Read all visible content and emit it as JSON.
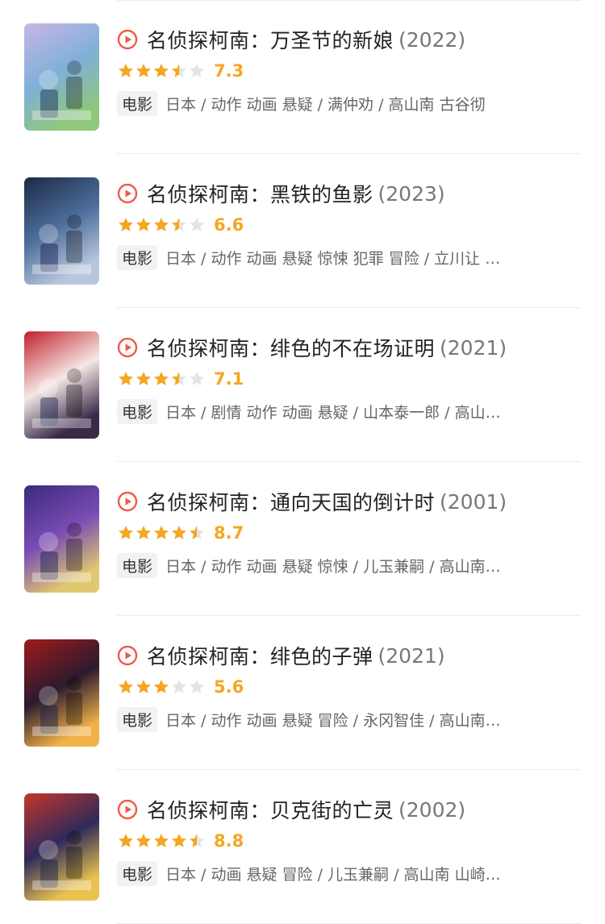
{
  "accent_color": "#f5a623",
  "play_icon_color": "#f15a4a",
  "items": [
    {
      "title": "名侦探柯南：万圣节的新娘",
      "year": "(2022)",
      "score": "7.3",
      "stars": 3.5,
      "type": "电影",
      "meta": "日本 / 动作 动画 悬疑 / 满仲劝 / 高山南 古谷彻",
      "poster_colors": [
        "#c7b6e6",
        "#7fb0d8",
        "#8fc77d"
      ]
    },
    {
      "title": "名侦探柯南：黑铁的鱼影",
      "year": "(2023)",
      "score": "6.6",
      "stars": 3.5,
      "type": "电影",
      "meta": "日本 / 动作 动画 悬疑 惊悚 犯罪 冒险 / 立川让 / 高山南 山崎和佳奈",
      "poster_colors": [
        "#1c2a44",
        "#4d6e9c",
        "#b7c6dc"
      ]
    },
    {
      "title": "名侦探柯南：绯色的不在场证明",
      "year": "(2021)",
      "score": "7.1",
      "stars": 3.5,
      "type": "电影",
      "meta": "日本 / 剧情 动作 动画 悬疑 / 山本泰一郎 / 高山南 山崎和佳奈",
      "poster_colors": [
        "#c21f2a",
        "#f4e8e4",
        "#3a2a4a"
      ]
    },
    {
      "title": "名侦探柯南：通向天国的倒计时",
      "year": "(2001)",
      "score": "8.7",
      "stars": 4.5,
      "type": "电影",
      "meta": "日本 / 动作 动画 悬疑 惊悚 / 儿玉兼嗣 / 高山南 山崎和佳奈",
      "poster_colors": [
        "#3b2a7a",
        "#7a4cb5",
        "#e0c870"
      ]
    },
    {
      "title": "名侦探柯南：绯色的子弹",
      "year": "(2021)",
      "score": "5.6",
      "stars": 3,
      "type": "电影",
      "meta": "日本 / 动作 动画 悬疑 冒险 / 永冈智佳 / 高山南 山崎和佳奈",
      "poster_colors": [
        "#9e1b1b",
        "#2c1a2e",
        "#f1b24a"
      ]
    },
    {
      "title": "名侦探柯南：贝克街的亡灵",
      "year": "(2002)",
      "score": "8.8",
      "stars": 4.5,
      "type": "电影",
      "meta": "日本 / 动画 悬疑 冒险 / 儿玉兼嗣 / 高山南 山崎和佳奈",
      "poster_colors": [
        "#c7342b",
        "#2e2a5a",
        "#e9c24f"
      ]
    }
  ]
}
